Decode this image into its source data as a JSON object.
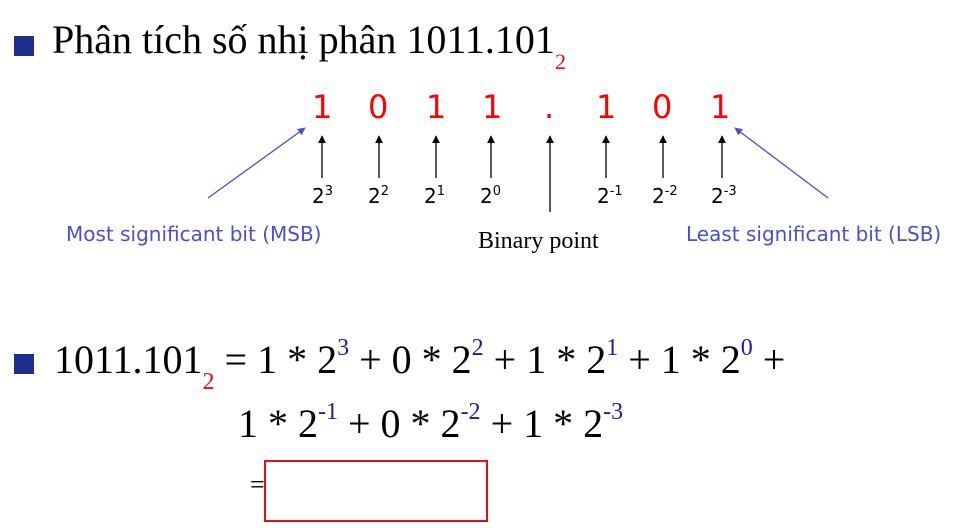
{
  "heading": {
    "text": "Phân tích số nhị phân 1011.101",
    "subscript": "2"
  },
  "digits": [
    "1",
    "0",
    "1",
    "1",
    ".",
    "1",
    "0",
    "1"
  ],
  "powers": [
    {
      "base": "2",
      "exp": "3"
    },
    {
      "base": "2",
      "exp": "2"
    },
    {
      "base": "2",
      "exp": "1"
    },
    {
      "base": "2",
      "exp": "0"
    },
    {
      "base": "2",
      "exp": "-1"
    },
    {
      "base": "2",
      "exp": "-2"
    },
    {
      "base": "2",
      "exp": "-3"
    }
  ],
  "labels": {
    "msb": "Most significant bit (MSB)",
    "binary_point": "Binary point",
    "lsb": "Least significant bit (LSB)"
  },
  "equation": {
    "lhs": "1011.101",
    "lhs_sub": "2",
    "line1": [
      {
        "t": " = 1 * 2"
      },
      {
        "s": "3"
      },
      {
        "t": " + 0 * 2"
      },
      {
        "s": "2"
      },
      {
        "t": " + 1 * 2"
      },
      {
        "s": "1"
      },
      {
        "t": " + 1 * 2"
      },
      {
        "s": "0"
      },
      {
        "t": " +"
      }
    ],
    "line2": [
      {
        "t": "1 * 2"
      },
      {
        "s": "-1"
      },
      {
        "t": " + 0 * 2"
      },
      {
        "s": "-2"
      },
      {
        "t": " + 1 * 2"
      },
      {
        "s": "-3"
      }
    ],
    "equals": "="
  },
  "colors": {
    "bullet": "#1f2e8f",
    "digit": "#ff0000",
    "note": "#4a4fcf",
    "superscript": "#1a1aa8",
    "box": "#e01010"
  }
}
